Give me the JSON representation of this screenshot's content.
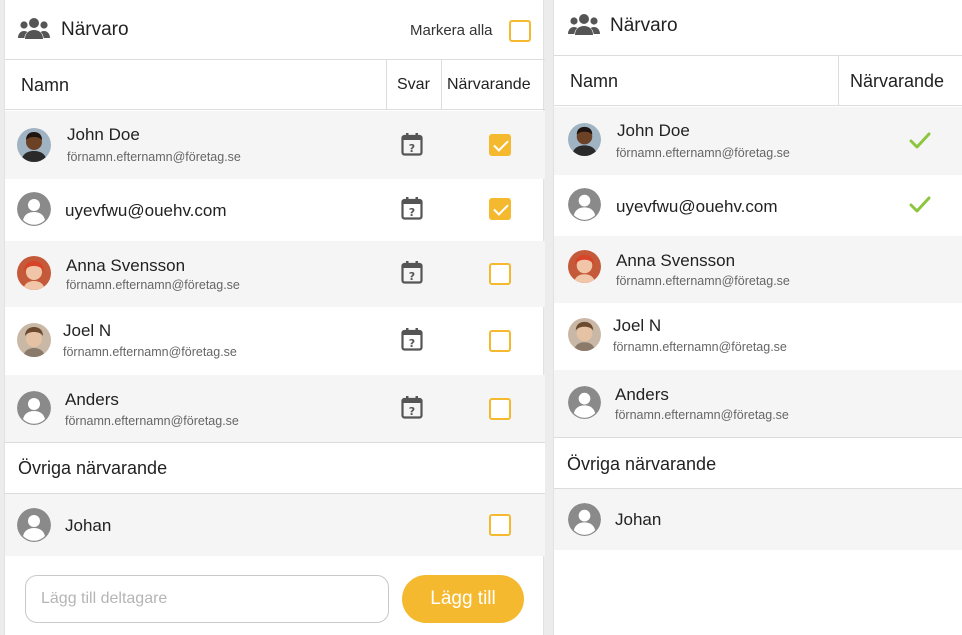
{
  "colors": {
    "accent": "#f4b92e",
    "check_green": "#8cc63f",
    "icon_gray": "#555555",
    "avatar_gray": "#8a8a8a"
  },
  "left": {
    "title": "Närvaro",
    "mark_all_label": "Markera alla",
    "mark_all_checked": false,
    "columns": {
      "name": "Namn",
      "answer": "Svar",
      "present": "Närvarande"
    },
    "participants": [
      {
        "name": "John Doe",
        "email": "förnamn.efternamn@företag.se",
        "avatar": "photo-man-dark",
        "answer_icon": "calendar-question-icon",
        "present": true
      },
      {
        "name": "uyevfwu@ouehv.com",
        "email": "",
        "avatar": "default-user-icon",
        "answer_icon": "calendar-question-icon",
        "present": true
      },
      {
        "name": "Anna Svensson",
        "email": "förnamn.efternamn@företag.se",
        "avatar": "photo-woman-red",
        "answer_icon": "calendar-question-icon",
        "present": false
      },
      {
        "name": "Joel N",
        "email": "förnamn.efternamn@företag.se",
        "avatar": "photo-man-light",
        "answer_icon": "calendar-question-icon",
        "present": false
      },
      {
        "name": "Anders",
        "email": "förnamn.efternamn@företag.se",
        "avatar": "default-user-icon",
        "answer_icon": "calendar-question-icon",
        "present": false
      }
    ],
    "others_title": "Övriga närvarande",
    "others": [
      {
        "name": "Johan",
        "avatar": "default-user-icon",
        "present": false
      }
    ],
    "add_placeholder": "Lägg till deltagare",
    "add_value": "",
    "add_button": "Lägg till"
  },
  "right": {
    "title": "Närvaro",
    "columns": {
      "name": "Namn",
      "present": "Närvarande"
    },
    "participants": [
      {
        "name": "John Doe",
        "email": "förnamn.efternamn@företag.se",
        "avatar": "photo-man-dark",
        "present": true
      },
      {
        "name": "uyevfwu@ouehv.com",
        "email": "",
        "avatar": "default-user-icon",
        "present": true
      },
      {
        "name": "Anna Svensson",
        "email": "förnamn.efternamn@företag.se",
        "avatar": "photo-woman-red",
        "present": false
      },
      {
        "name": "Joel N",
        "email": "förnamn.efternamn@företag.se",
        "avatar": "photo-man-light",
        "present": false
      },
      {
        "name": "Anders",
        "email": "förnamn.efternamn@företag.se",
        "avatar": "default-user-icon",
        "present": false
      }
    ],
    "others_title": "Övriga närvarande",
    "others": [
      {
        "name": "Johan",
        "avatar": "default-user-icon",
        "present": false
      }
    ]
  }
}
